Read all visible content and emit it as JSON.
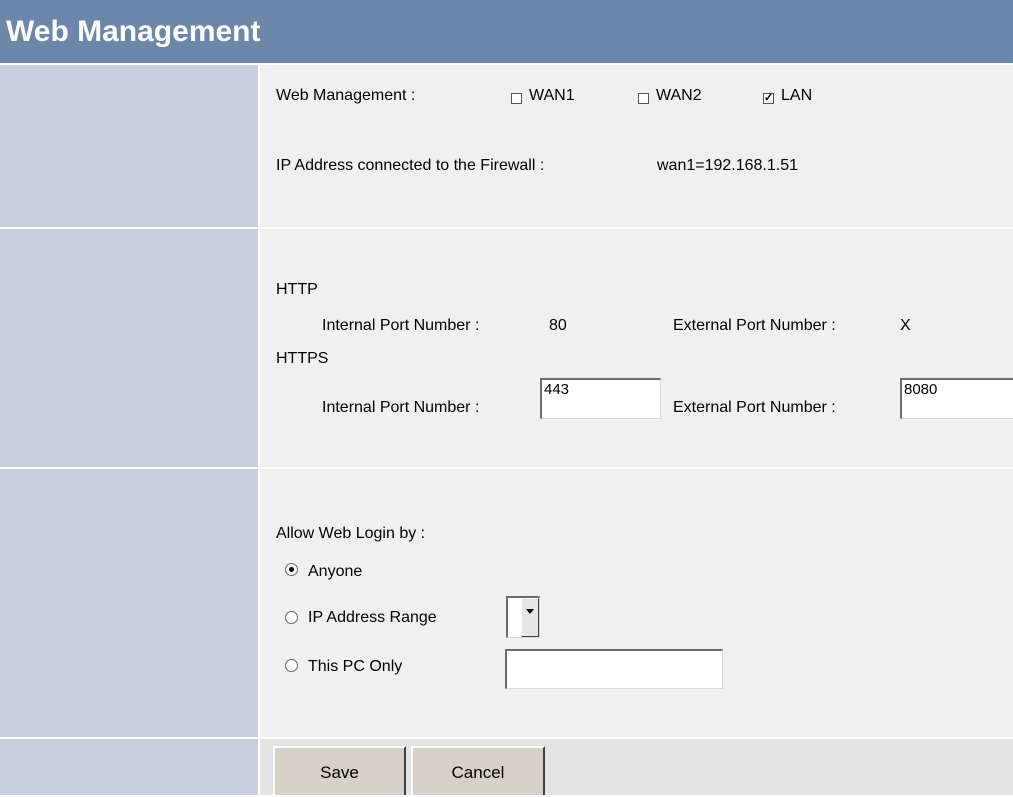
{
  "header": {
    "title": "Web Management"
  },
  "management": {
    "label": "Web Management :",
    "options": [
      {
        "label": "WAN1",
        "checked": false
      },
      {
        "label": "WAN2",
        "checked": false
      },
      {
        "label": "LAN",
        "checked": true
      }
    ],
    "ip_label": "IP Address connected to the Firewall :",
    "ip_value": "wan1=192.168.1.51"
  },
  "ports": {
    "http_title": "HTTP",
    "http_internal_label": "Internal Port Number :",
    "http_internal_value": "80",
    "http_external_label": "External Port Number :",
    "http_external_value": "X",
    "https_title": "HTTPS",
    "https_internal_label": "Internal Port Number :",
    "https_internal_value": "443",
    "https_external_label": "External Port Number :",
    "https_external_value": "8080"
  },
  "login": {
    "label": "Allow Web Login by :",
    "options": [
      {
        "label": "Anyone",
        "selected": true
      },
      {
        "label": "IP Address Range",
        "selected": false
      },
      {
        "label": "This PC Only",
        "selected": false
      }
    ],
    "ip_range_selected": "",
    "this_pc_value": ""
  },
  "actions": {
    "save_label": "Save",
    "cancel_label": "Cancel"
  }
}
